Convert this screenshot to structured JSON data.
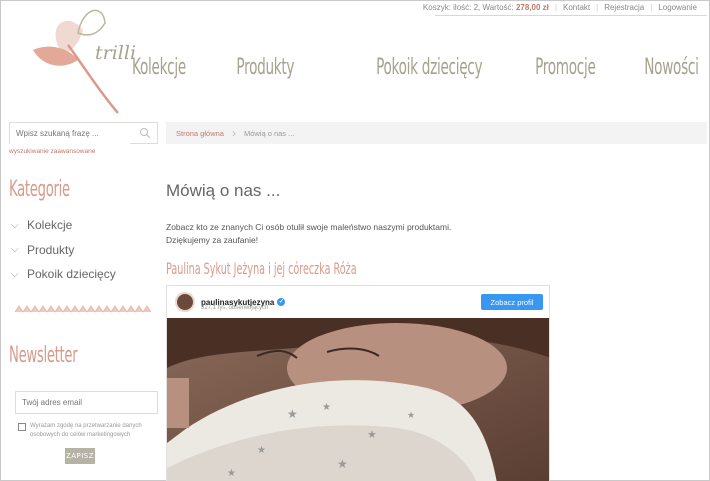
{
  "topbar": {
    "cart_prefix": "Koszyk: ilość: 2, Wartość:",
    "cart_price": "278,00 zł",
    "contact": "Kontakt",
    "register": "Rejestracja",
    "login": "Logowanie"
  },
  "logo": {
    "text": "trilli"
  },
  "nav": [
    "Kolekcje",
    "Produkty",
    "Pokoik dziecięcy",
    "Promocje",
    "Nowości"
  ],
  "search": {
    "placeholder": "Wpisz szukaną frazę ...",
    "advanced": "wyszukiwanie zaawansowane",
    "icon": "search-icon"
  },
  "breadcrumb": {
    "home": "Strona główna",
    "current": "Mówią o nas ..."
  },
  "sidebar": {
    "categories_title": "Kategorie",
    "categories": [
      "Kolekcje",
      "Produkty",
      "Pokoik dziecięcy"
    ],
    "newsletter_title": "Newsletter",
    "email_placeholder": "Twój adres email",
    "consent": "Wyrażam zgodę na przetwarzanie danych osobowych do celów marketingowych",
    "submit": "ZAPISZ"
  },
  "main": {
    "title": "Mówią o nas ...",
    "intro_line1": "Zobacz kto ze znanych Ci osób otulił swoje maleństwo naszymi produktami.",
    "intro_line2": "Dziękujemy za zaufanie!",
    "section_title": "Paulina Sykut Jeżyna i jej córeczka Róża"
  },
  "instagram": {
    "username": "paulinasykutjezyna",
    "followers": "327,1 tys. obserwujących",
    "button": "Zobacz profil"
  },
  "colors": {
    "accent": "#d99a8c",
    "nav": "#a5a38f",
    "link": "#c07a6e",
    "insta_blue": "#3897f0"
  }
}
